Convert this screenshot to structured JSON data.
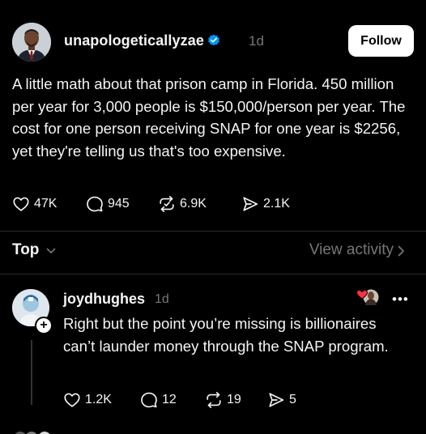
{
  "post": {
    "username": "unapologeticallyzae",
    "time": "1d",
    "follow_label": "Follow",
    "text": "A little math about that prison camp in Florida. 450 million per year for 3,000 people is $150,000/person per year. The cost for one person receiving SNAP for one year is $2256, yet they're telling us that's too expensive.",
    "likes": "47K",
    "replies": "945",
    "reposts": "6.9K",
    "shares": "2.1K"
  },
  "sort": {
    "label": "Top",
    "view_activity": "View activity"
  },
  "reply": {
    "username": "joydhughes",
    "time": "1d",
    "more": "•••",
    "text": "Right but the point you’re missing is billionaires can’t launder money through the SNAP program.",
    "likes": "1.2K",
    "replies": "12",
    "reposts": "19",
    "shares": "5"
  },
  "colors": {
    "background": "#000000",
    "text": "#f3f5f7",
    "muted": "#777777",
    "verified": "#0095f6",
    "like_red": "#ff3040"
  },
  "icons": [
    "verified-icon",
    "heart-icon",
    "comment-icon",
    "repost-icon",
    "share-icon",
    "chevron-down-icon",
    "chevron-right-icon",
    "plus-icon",
    "more-icon"
  ]
}
